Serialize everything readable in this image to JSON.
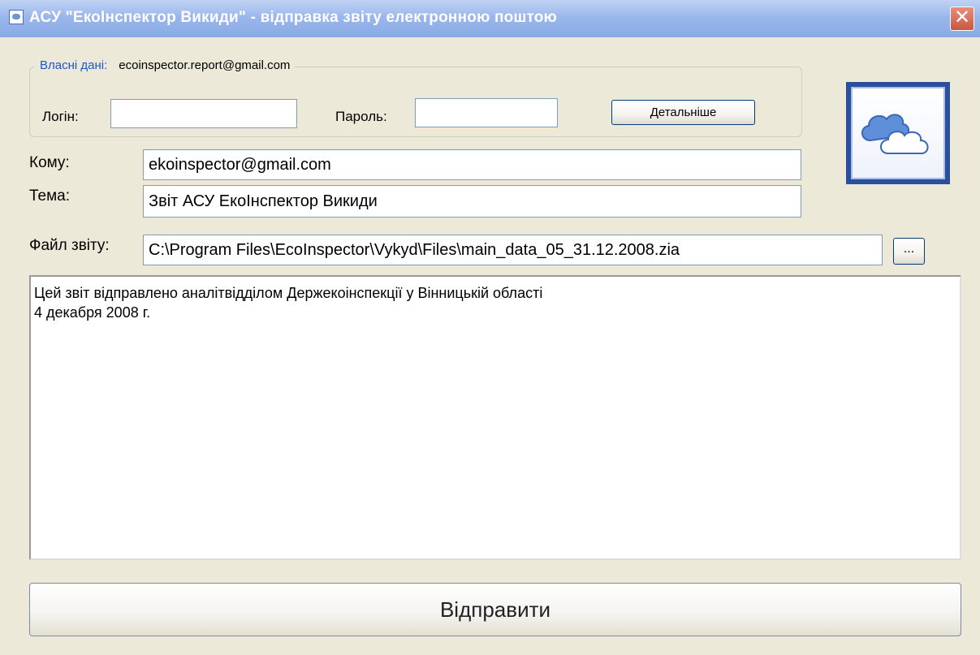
{
  "window": {
    "title": "АСУ \"ЕкоІнспектор Викиди\" - відправка звіту електронною поштою",
    "close_glyph": "✕"
  },
  "own_data": {
    "legend": "Власні дані:",
    "email": "ecoinspector.report@gmail.com",
    "login_label": "Логін:",
    "login_value": "",
    "password_label": "Пароль:",
    "password_value": "",
    "details_button": "Детальніше"
  },
  "form": {
    "to_label": "Кому:",
    "to_value": "ekoinspector@gmail.com",
    "subject_label": "Тема:",
    "subject_value": "Звіт АСУ ЕкоІнспектор Викиди",
    "file_label": "Файл звіту:",
    "file_value": "C:\\Program Files\\EcoInspector\\Vykyd\\Files\\main_data_05_31.12.2008.zia",
    "browse_button": "...",
    "message_lines": [
      "Цей звіт відправлено аналітвідділом Держекоінспекції у Вінницькій області",
      "4 декабря 2008 г."
    ]
  },
  "send_button": "Відправити",
  "icons": {
    "title": "app-window-icon",
    "logo": "cloud-logo-icon"
  },
  "colors": {
    "titlebar": "#9ab7ec",
    "legend_text": "#1c57c8",
    "close_button": "#c9573f",
    "logo_frame": "#2b4f9a"
  }
}
